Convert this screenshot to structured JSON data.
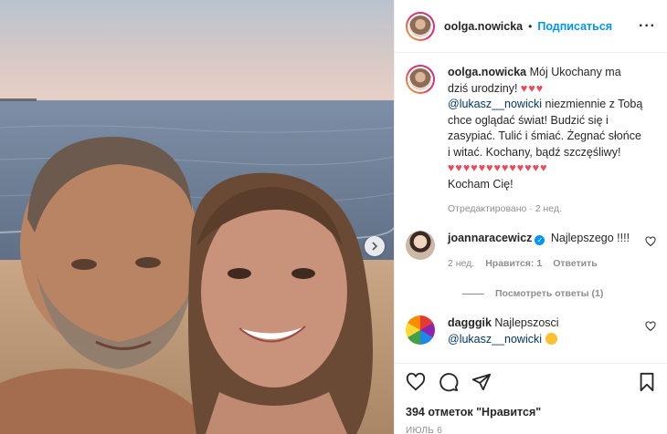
{
  "post": {
    "username": "oolga.nowicka",
    "separator": "•",
    "follow_label": "Подписаться",
    "more_label": "···",
    "caption": {
      "text_before": "Mój Ukochany ma dziś urodziny!",
      "hearts_line1": "♥♥♥",
      "mention": "@lukasz__nowicki",
      "text_after": "niezmiennie z Tobą chce oglądać świat! Budzić się i zasypiać. Tulić i śmiać. Żegnać słońce i witać. Kochany, bądź szczęśliwy!",
      "hearts_line2": "♥♥♥♥♥♥♥♥♥♥♥♥♥",
      "closing": "Kocham Cię!",
      "meta": "Отредактировано · 2 нед."
    }
  },
  "comments": [
    {
      "username": "joannaracewicz",
      "verified": "✓",
      "text": "Najlepszego !!!!",
      "age": "2 нед.",
      "likes": "Нравится: 1",
      "reply": "Ответить",
      "view_replies": "Посмотреть ответы (1)"
    },
    {
      "username": "dagggik",
      "text": "Najlepszosci",
      "mention": "@lukasz__nowicki"
    }
  ],
  "footer": {
    "likes": "394 отметок \"Нравится\"",
    "date": "ИЮЛЬ 6"
  },
  "icons": [
    "heart-icon",
    "comment-icon",
    "share-icon",
    "bookmark-icon",
    "chevron-right-icon",
    "more-icon",
    "verified-icon"
  ],
  "colors": {
    "accent": "#0095f6",
    "heart": "#ed4956",
    "muted": "#8e8e8e",
    "mention": "#00376b"
  }
}
